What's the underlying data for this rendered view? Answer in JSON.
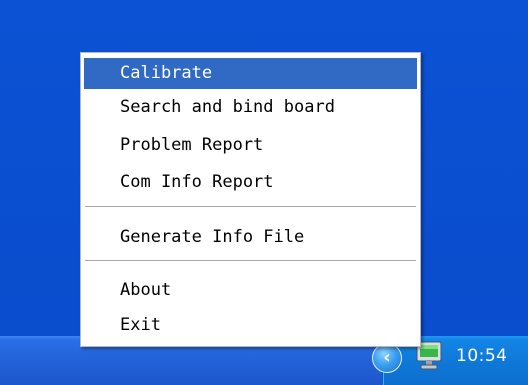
{
  "context_menu": {
    "items": [
      {
        "label": "Calibrate",
        "selected": true
      },
      {
        "label": "Search and bind board",
        "selected": false
      },
      {
        "label": "Problem Report",
        "selected": false
      },
      {
        "label": "Com Info Report",
        "selected": false
      },
      {
        "label": "Generate Info File",
        "selected": false
      },
      {
        "label": "About",
        "selected": false
      },
      {
        "label": "Exit",
        "selected": false
      }
    ]
  },
  "taskbar": {
    "clock": "10:54",
    "tray_icons": [
      "show-hidden-icons-chevron-icon",
      "monitor-app-icon"
    ]
  },
  "colors": {
    "desktop": "#0a4fd0",
    "highlight": "#316ac5",
    "taskbar": "#2463da",
    "tray": "#0f79d8"
  }
}
